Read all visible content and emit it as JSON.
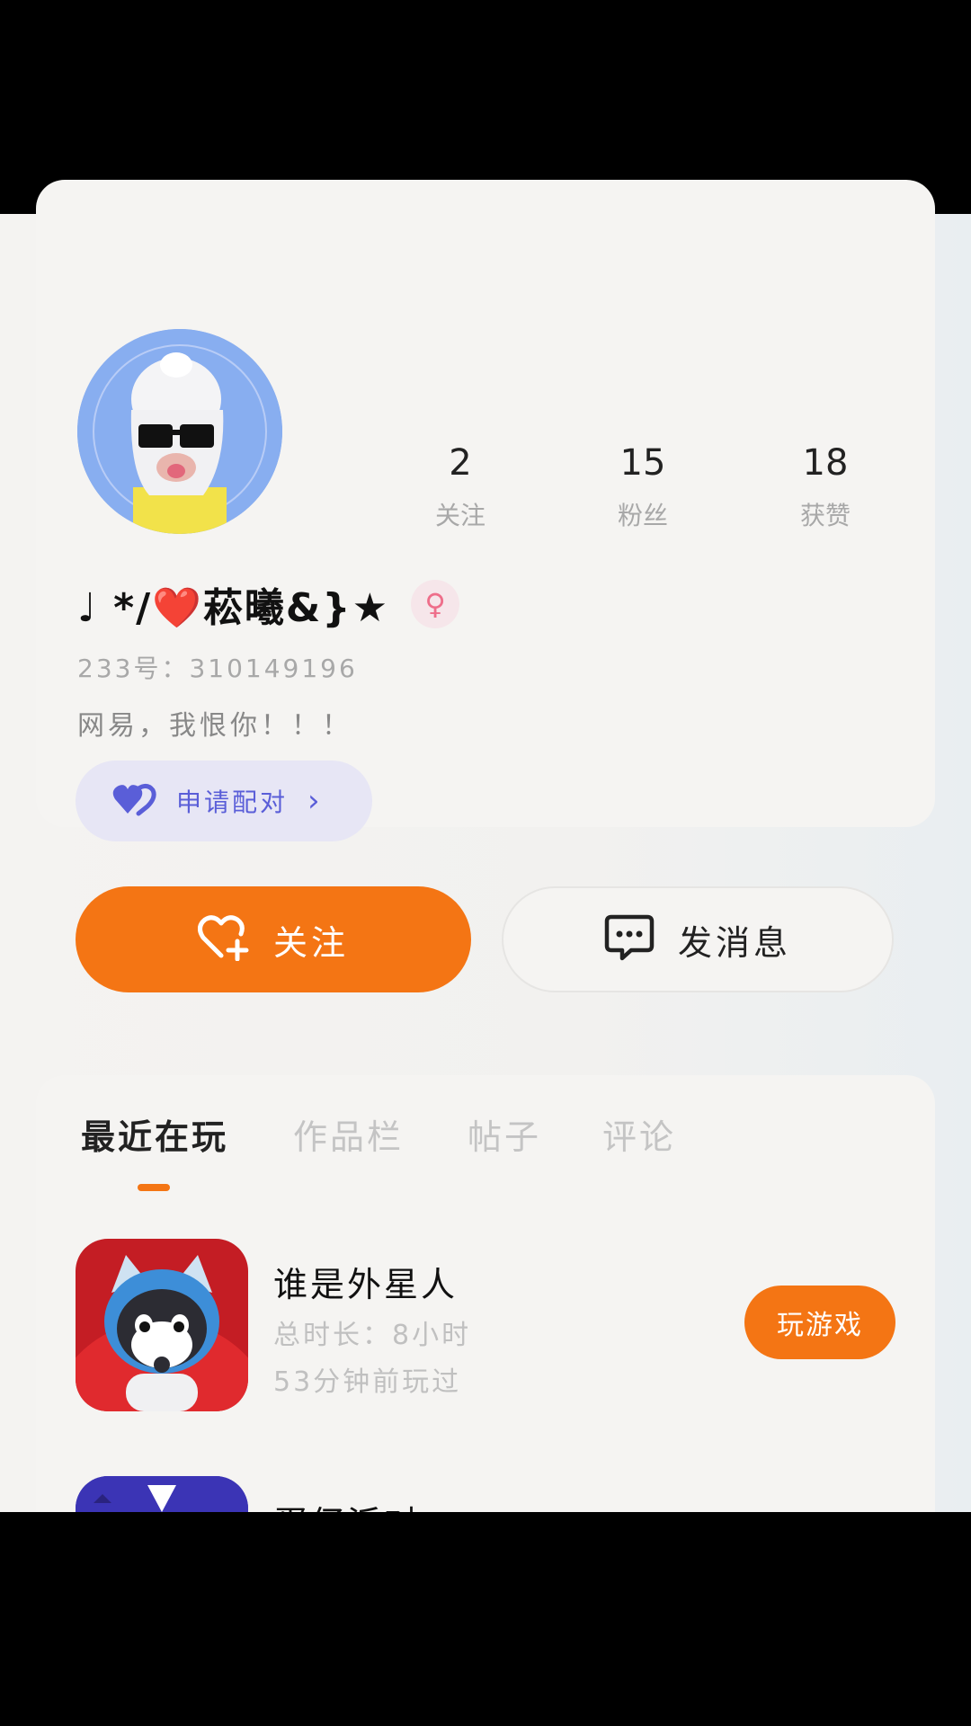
{
  "profile": {
    "name": "♩ */❤️菘曦&}★",
    "gender_symbol": "♀",
    "uid": "233号：310149196",
    "bio": "网易，我恨你！！！",
    "pair_button": {
      "label": "申请配对",
      "chevron": "›"
    }
  },
  "stats": [
    {
      "value": "2",
      "label": "关注"
    },
    {
      "value": "15",
      "label": "粉丝"
    },
    {
      "value": "18",
      "label": "获赞"
    }
  ],
  "actions": {
    "follow_label": "关注",
    "message_label": "发消息"
  },
  "tabs": [
    "最近在玩",
    "作品栏",
    "帖子",
    "评论"
  ],
  "games": [
    {
      "title": "谁是外星人",
      "total_time": "总时长：8小时",
      "last_played": "53分钟前玩过",
      "play_label": "玩游戏"
    },
    {
      "title": "蛋仔派对"
    }
  ],
  "colors": {
    "accent": "#f47514",
    "pair_purple": "#5a5ed8",
    "gender_pink": "#ee6e8a"
  },
  "icons": {
    "follow": "heart-plus-icon",
    "message": "chat-bubble-icon",
    "pair": "double-heart-icon",
    "gender": "female-icon"
  }
}
